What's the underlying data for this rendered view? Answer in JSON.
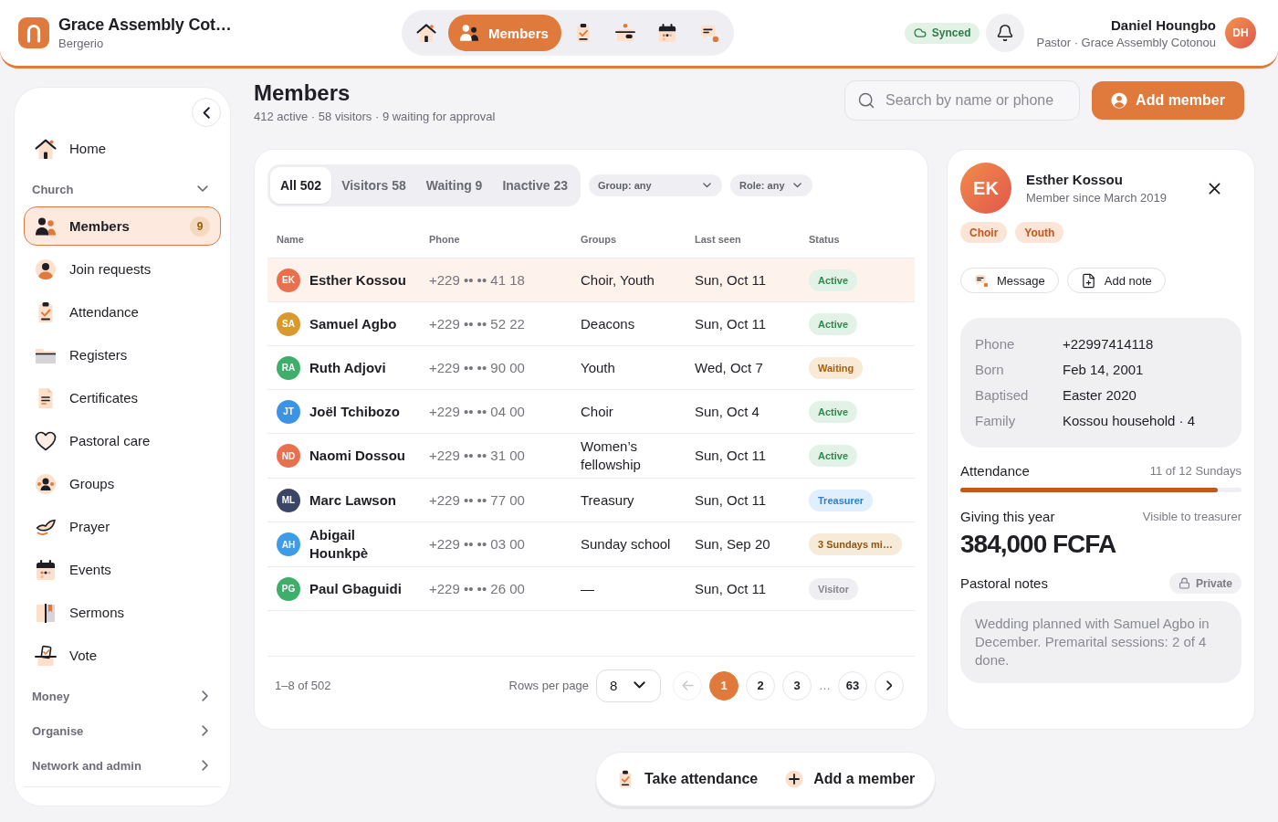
{
  "header": {
    "app": {
      "title": "Grace Assembly Cot…",
      "subtitle": "Bergerio"
    },
    "nav": [
      {
        "selected": false
      },
      {
        "label": "Members",
        "selected": true
      },
      {
        "selected": false
      },
      {
        "selected": false
      },
      {
        "selected": false
      },
      {
        "selected": false
      }
    ],
    "sync": {
      "label": "Synced"
    },
    "user": {
      "name": "Daniel Houngbo",
      "role": "Pastor · Grace Assembly Cotonou",
      "initials": "DH"
    }
  },
  "sidebar": {
    "items": [
      {
        "label": "Home",
        "selected": false
      }
    ],
    "sections": [
      {
        "title": "Church",
        "expanded": true,
        "items": [
          {
            "label": "Members",
            "selected": true,
            "badge": "9"
          },
          {
            "label": "Join requests",
            "selected": false
          },
          {
            "label": "Attendance",
            "selected": false
          },
          {
            "label": "Registers",
            "selected": false
          },
          {
            "label": "Certificates",
            "selected": false
          },
          {
            "label": "Pastoral care",
            "selected": false
          },
          {
            "label": "Groups",
            "selected": false
          },
          {
            "label": "Prayer",
            "selected": false
          },
          {
            "label": "Events",
            "selected": false
          },
          {
            "label": "Sermons",
            "selected": false
          },
          {
            "label": "Vote",
            "selected": false
          }
        ]
      },
      {
        "title": "Money",
        "expanded": false
      },
      {
        "title": "Organise",
        "expanded": false
      },
      {
        "title": "Network and admin",
        "expanded": false
      }
    ]
  },
  "page": {
    "title": "Members",
    "summary": "412 active · 58 visitors · 9 waiting for approval",
    "search": {
      "placeholder": "Search by name or phone"
    },
    "add_button": "Add member"
  },
  "members_table": {
    "tabs": [
      {
        "label": "All 502",
        "selected": true
      },
      {
        "label": "Visitors 58",
        "selected": false
      },
      {
        "label": "Waiting 9",
        "selected": false
      },
      {
        "label": "Inactive 23",
        "selected": false
      }
    ],
    "filters": [
      {
        "label": "Group: any"
      },
      {
        "label": "Role: any"
      }
    ],
    "columns": [
      "Name",
      "Phone",
      "Groups",
      "Last seen",
      "Status"
    ],
    "rows": [
      {
        "initials": "EK",
        "color": "#e9704f",
        "name": "Esther Kossou",
        "phone": "+229 •• •• 41 18",
        "groups": "Choir, Youth",
        "last_seen": "Sun, Oct 11",
        "status": {
          "label": "Active",
          "kind": "active"
        },
        "selected": true
      },
      {
        "initials": "SA",
        "color": "#d89a2c",
        "name": "Samuel Agbo",
        "phone": "+229 •• •• 52 22",
        "groups": "Deacons",
        "last_seen": "Sun, Oct 11",
        "status": {
          "label": "Active",
          "kind": "active"
        },
        "selected": false
      },
      {
        "initials": "RA",
        "color": "#3fae6b",
        "name": "Ruth Adjovi",
        "phone": "+229 •• •• 90 00",
        "groups": "Youth",
        "last_seen": "Wed, Oct 7",
        "status": {
          "label": "Waiting",
          "kind": "waiting"
        },
        "selected": false
      },
      {
        "initials": "JT",
        "color": "#3c93e6",
        "name": "Joël Tchibozo",
        "phone": "+229 •• •• 04 00",
        "groups": "Choir",
        "last_seen": "Sun, Oct 4",
        "status": {
          "label": "Active",
          "kind": "active"
        },
        "selected": false
      },
      {
        "initials": "ND",
        "color": "#e9704f",
        "name": "Naomi Dossou",
        "phone": "+229 •• •• 31 00",
        "groups": "Women’s fellowship",
        "last_seen": "Sun, Oct 11",
        "status": {
          "label": "Active",
          "kind": "active"
        },
        "selected": false
      },
      {
        "initials": "ML",
        "color": "#3b4566",
        "name": "Marc Lawson",
        "phone": "+229 •• •• 77 00",
        "groups": "Treasury",
        "last_seen": "Sun, Oct 11",
        "status": {
          "label": "Treasurer",
          "kind": "role"
        },
        "selected": false
      },
      {
        "initials": "AH",
        "color": "#3d9be8",
        "name": "Abigail Hounkpè",
        "phone": "+229 •• •• 03 00",
        "groups": "Sunday school",
        "last_seen": "Sun, Sep 20",
        "status": {
          "label": "3 Sundays mi…",
          "kind": "alert"
        },
        "selected": false
      },
      {
        "initials": "PG",
        "color": "#3fae6b",
        "name": "Paul Gbaguidi",
        "phone": "+229 •• •• 26 00",
        "groups": "—",
        "last_seen": "Sun, Oct 11",
        "status": {
          "label": "Visitor",
          "kind": "visitor"
        },
        "selected": false
      }
    ],
    "footer": {
      "range": "1–8 of 502",
      "rows_per_page": {
        "label": "Rows per page",
        "value": "8"
      }
    },
    "pagination": {
      "previous": {
        "disabled": true
      },
      "pages": [
        {
          "label": "1",
          "selected": true
        },
        {
          "label": "2",
          "selected": false
        },
        {
          "label": "3",
          "selected": false
        },
        {
          "label": "63",
          "selected": false
        }
      ],
      "ellipsis": "…",
      "next": {
        "disabled": false
      }
    }
  },
  "member_detail": {
    "initials": "EK",
    "name": "Esther Kossou",
    "since": "Member since March 2019",
    "tags": [
      "Choir",
      "Youth"
    ],
    "actions": [
      "Message",
      "Add note"
    ],
    "fields": [
      {
        "label": "Phone",
        "value": "+22997414118"
      },
      {
        "label": "Born",
        "value": "Feb 14, 2001"
      },
      {
        "label": "Baptised",
        "value": "Easter 2020"
      },
      {
        "label": "Family",
        "value": "Kossou household · 4"
      }
    ],
    "attendance": {
      "label": "Attendance",
      "reading": "11 of 12 Sundays",
      "level": 0.917
    },
    "giving": {
      "label": "Giving this year",
      "note": "Visible to treasurer",
      "amount": "384,000 FCFA"
    },
    "notes": {
      "label": "Pastoral notes",
      "privacy": "Private",
      "text": "Wedding planned with Samuel Agbo in December. Premarital sessions: 2 of 4 done."
    }
  },
  "quick_actions": [
    {
      "label": "Take attendance"
    },
    {
      "label": "Add a member"
    }
  ]
}
